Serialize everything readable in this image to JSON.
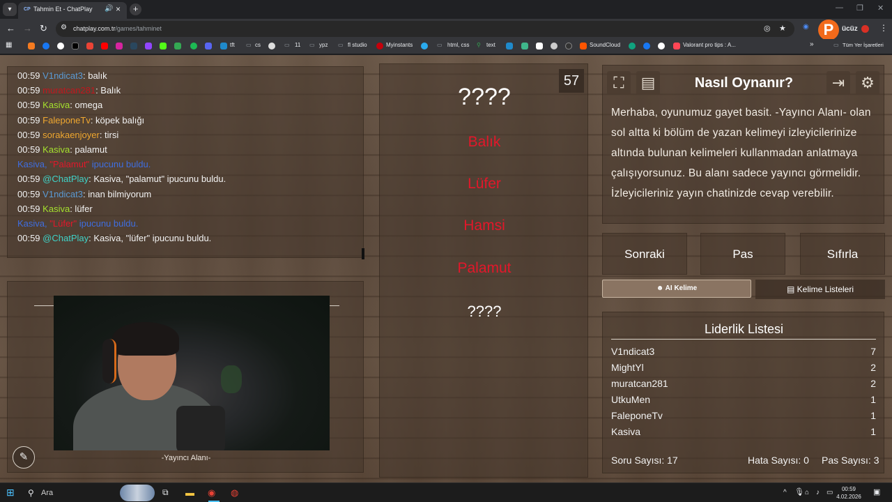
{
  "browser": {
    "tab_title": "Tahmin Et - ChatPlay",
    "tab_favicon": "CP",
    "url_host": "chatplay.com.tr",
    "url_path": "/games/tahminet",
    "all_bookmarks_label": "Tüm Yer İşaretleri",
    "extension_label": "ücüz",
    "bookmarks": [
      {
        "label": "tft",
        "icon": "tft-icon"
      },
      {
        "label": "cs",
        "icon": "folder-icon"
      },
      {
        "label": "11",
        "icon": "folder-icon"
      },
      {
        "label": "ypz",
        "icon": "folder-icon"
      },
      {
        "label": "fl studio",
        "icon": "folder-icon"
      },
      {
        "label": "Myinstants",
        "icon": "myinstants-icon"
      },
      {
        "label": "html, css",
        "icon": "folder-icon"
      },
      {
        "label": "text",
        "icon": "text-icon"
      },
      {
        "label": "SoundCloud",
        "icon": "soundcloud-icon"
      },
      {
        "label": "Valorant pro tips : A...",
        "icon": "valorant-icon"
      }
    ]
  },
  "chat": {
    "lines": [
      {
        "time": "00:59",
        "user": "V1ndicat3",
        "color": "#5b9bd5",
        "text": ": balık"
      },
      {
        "time": "00:59",
        "user": "muratcan281",
        "color": "#c0161d",
        "text": ": Balık"
      },
      {
        "time": "00:59",
        "user": "Kasiva",
        "color": "#a6e22e",
        "text": ": omega"
      },
      {
        "time": "00:59",
        "user": "FaleponeTv",
        "color": "#f0a830",
        "text": ": köpek balığı"
      },
      {
        "time": "00:59",
        "user": "sorakaenjoyer",
        "color": "#f0a830",
        "text": ": tirsi"
      },
      {
        "time": "00:59",
        "user": "Kasiva",
        "color": "#a6e22e",
        "text": ": palamut"
      },
      {
        "system": true,
        "user": "Kasiva,",
        "word": " \"Palamut\"",
        "rest": " ipucunu buldu."
      },
      {
        "time": "00:59",
        "user": "@ChatPlay",
        "color": "#3fd2c7",
        "text": ": Kasiva, \"palamut\" ipucunu buldu."
      },
      {
        "time": "00:59",
        "user": "V1ndicat3",
        "color": "#5b9bd5",
        "text": ": inan bilmiyorum"
      },
      {
        "time": "00:59",
        "user": "Kasiva",
        "color": "#a6e22e",
        "text": ": lüfer"
      },
      {
        "system": true,
        "user": "Kasiva,",
        "word": " \"Lüfer\"",
        "rest": " ipucunu buldu."
      },
      {
        "time": "00:59",
        "user": "@ChatPlay",
        "color": "#3fd2c7",
        "text": ": Kasiva, \"lüfer\" ipucunu buldu."
      }
    ]
  },
  "streamer": {
    "label": "-Yayıncı Alanı-"
  },
  "word_panel": {
    "hidden_word": "????",
    "forbidden": [
      "Balık",
      "Lüfer",
      "Hamsi",
      "Palamut"
    ],
    "next_word": "????",
    "timer": "57"
  },
  "howto": {
    "title": "Nasıl Oynanır?",
    "text": "Merhaba, oyunumuz gayet basit. -Yayıncı Alanı- olan sol altta ki bölüm de yazan kelimeyi izleyicilerinize altında bulunan kelimeleri kullanmadan anlatmaya çalışıyorsunuz. Bu alanı sadece yayıncı görmelidir. İzleyicileriniz yayın chatinizde cevap verebilir."
  },
  "actions": {
    "next": "Sonraki",
    "pass": "Pas",
    "reset": "Sıfırla",
    "ai_word": "AI Kelime",
    "word_lists": "Kelime Listeleri"
  },
  "leaderboard": {
    "title": "Liderlik Listesi",
    "rows": [
      {
        "name": "V1ndicat3",
        "score": "7"
      },
      {
        "name": "MightYl",
        "score": "2"
      },
      {
        "name": "muratcan281",
        "score": "2"
      },
      {
        "name": "UtkuMen",
        "score": "1"
      },
      {
        "name": "FaleponeTv",
        "score": "1"
      },
      {
        "name": "Kasiva",
        "score": "1"
      }
    ],
    "question_count": "Soru Sayısı: 17",
    "error_count": "Hata Sayısı: 0",
    "pass_count": "Pas Sayısı: 3"
  },
  "taskbar": {
    "search": "Ara",
    "time": "00:59",
    "date": "4.02.2026"
  },
  "colors": {
    "forbidden_red": "#e3172a",
    "system_blue": "#3f6ee0",
    "wood": "#5d4b3d"
  }
}
